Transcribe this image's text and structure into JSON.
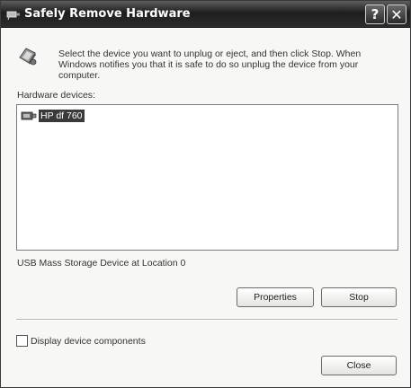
{
  "window": {
    "title": "Safely Remove Hardware",
    "help_label": "?",
    "close_label": "✕"
  },
  "instructions": "Select the device you want to unplug or eject, and then click Stop. When Windows notifies you that it is safe to do so unplug the device from your computer.",
  "hardware_label": "Hardware devices:",
  "devices": [
    {
      "label": "HP df 760",
      "icon": "usb-device-icon",
      "selected": true
    }
  ],
  "device_description": "USB Mass Storage Device at Location 0",
  "buttons": {
    "properties": "Properties",
    "stop": "Stop",
    "close": "Close"
  },
  "checkbox": {
    "label": "Display device components",
    "checked": false
  }
}
